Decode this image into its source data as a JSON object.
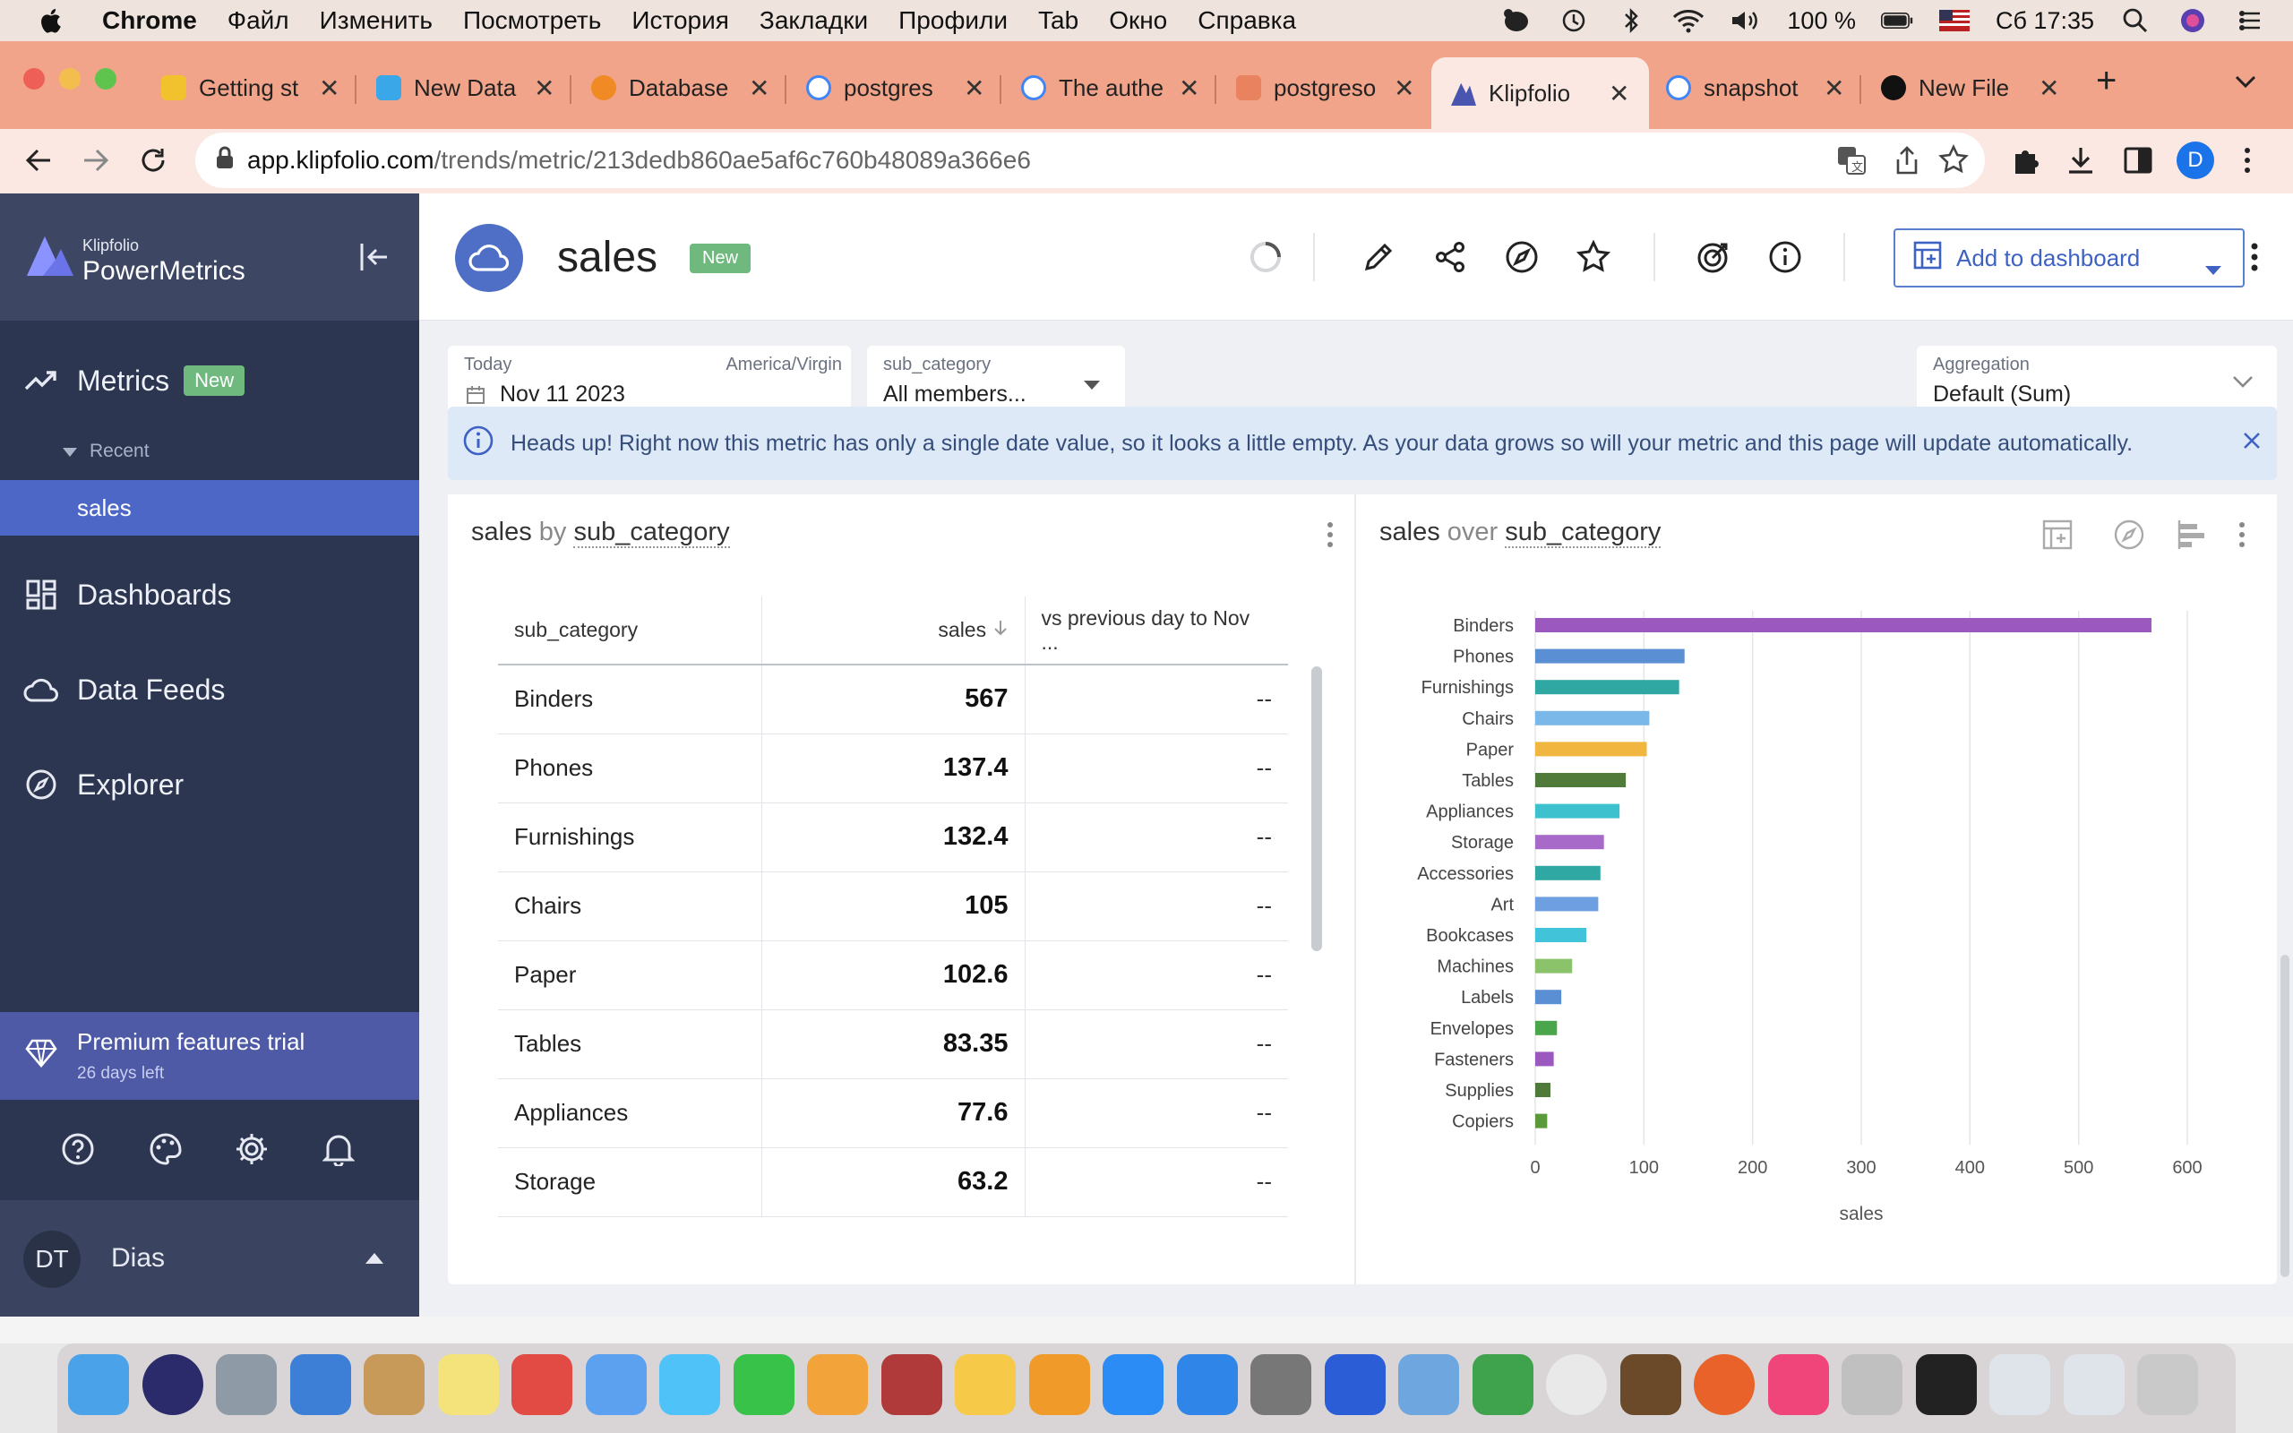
{
  "menubar": {
    "app": "Chrome",
    "items": [
      "Файл",
      "Изменить",
      "Посмотреть",
      "История",
      "Закладки",
      "Профили",
      "Tab",
      "Окно",
      "Справка"
    ],
    "battery": "100 %",
    "clock": "Сб 17:35"
  },
  "tabs": [
    {
      "label": "Getting st",
      "color": "#f2c12e"
    },
    {
      "label": "New Data",
      "color": "#3aa7e8"
    },
    {
      "label": "Database",
      "color": "#f08a24"
    },
    {
      "label": "postgres",
      "color": "#ffffff"
    },
    {
      "label": "The authe",
      "color": "#ffffff"
    },
    {
      "label": "postgreso",
      "color": "#e8825f"
    },
    {
      "label": "Klipfolio",
      "color": "#4a55b0"
    },
    {
      "label": "snapshot",
      "color": "#ffffff"
    },
    {
      "label": "New File",
      "color": "#111111"
    }
  ],
  "address": {
    "host": "app.klipfolio.com",
    "path": "/trends/metric/213dedb860ae5af6c760b48089a366e6",
    "profile_initial": "D"
  },
  "sidebar": {
    "brand_small": "Klipfolio",
    "brand": "PowerMetrics",
    "metrics_label": "Metrics",
    "new_badge": "New",
    "recent_label": "Recent",
    "recent_item": "sales",
    "dashboards": "Dashboards",
    "data_feeds": "Data Feeds",
    "explorer": "Explorer",
    "premium_title": "Premium features trial",
    "premium_sub": "26 days left",
    "user_initials": "DT",
    "user_name": "Dias"
  },
  "header": {
    "title": "sales",
    "badge": "New",
    "add_button": "Add to dashboard"
  },
  "filters": {
    "date_label": "Today",
    "timezone": "America/Virgin",
    "date_value": "Nov 11 2023",
    "subcat_label": "sub_category",
    "subcat_value": "All members...",
    "agg_label": "Aggregation",
    "agg_value": "Default (Sum)"
  },
  "info": {
    "message": "Heads up! Right now this metric has only a single date value, so it looks a little empty. As your data grows so will your metric and this page will update automatically."
  },
  "table_card": {
    "title_a": "sales",
    "title_by": "by",
    "title_b": "sub_category",
    "headers": [
      "sub_category",
      "sales",
      "vs previous day to Nov ..."
    ],
    "rows": [
      {
        "name": "Binders",
        "value": "567",
        "cmp": "--"
      },
      {
        "name": "Phones",
        "value": "137.4",
        "cmp": "--"
      },
      {
        "name": "Furnishings",
        "value": "132.4",
        "cmp": "--"
      },
      {
        "name": "Chairs",
        "value": "105",
        "cmp": "--"
      },
      {
        "name": "Paper",
        "value": "102.6",
        "cmp": "--"
      },
      {
        "name": "Tables",
        "value": "83.35",
        "cmp": "--"
      },
      {
        "name": "Appliances",
        "value": "77.6",
        "cmp": "--"
      },
      {
        "name": "Storage",
        "value": "63.2",
        "cmp": "--"
      }
    ]
  },
  "chart_card": {
    "title_a": "sales",
    "title_over": "over",
    "title_b": "sub_category"
  },
  "chart_data": {
    "type": "bar",
    "orientation": "horizontal",
    "categories": [
      "Binders",
      "Phones",
      "Furnishings",
      "Chairs",
      "Paper",
      "Tables",
      "Appliances",
      "Storage",
      "Accessories",
      "Art",
      "Bookcases",
      "Machines",
      "Labels",
      "Envelopes",
      "Fasteners",
      "Supplies",
      "Copiers"
    ],
    "values": [
      567,
      137.4,
      132.4,
      105,
      102.6,
      83.35,
      77.6,
      63.2,
      60,
      58,
      47,
      34,
      24,
      20,
      17,
      14,
      11
    ],
    "colors": [
      "#9b59c0",
      "#5b8fd4",
      "#2fa7a3",
      "#7ab8ea",
      "#f0b63f",
      "#4f7a3a",
      "#3ec1cf",
      "#a86ac9",
      "#2fa7a3",
      "#6e9fe0",
      "#41c3d9",
      "#8bc36a",
      "#5b8fd4",
      "#4aa64a",
      "#9b59c0",
      "#4f7a3a",
      "#5b9a3a"
    ],
    "xlim": [
      0,
      600
    ],
    "xticks": [
      "0",
      "100",
      "200",
      "300",
      "400",
      "500",
      "600"
    ],
    "xlabel": "sales",
    "grid": true
  }
}
